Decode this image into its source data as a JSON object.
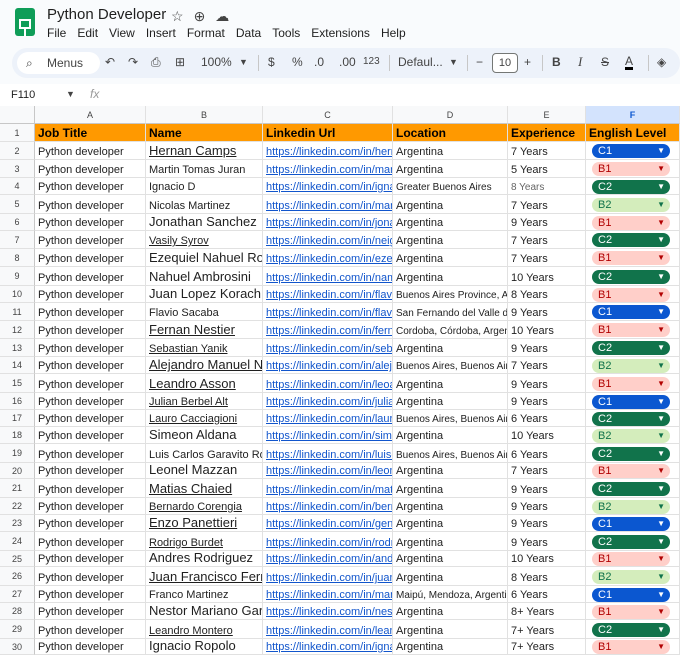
{
  "doc": {
    "title": "Python Developer"
  },
  "menu": [
    "File",
    "Edit",
    "View",
    "Insert",
    "Format",
    "Data",
    "Tools",
    "Extensions",
    "Help"
  ],
  "toolbar": {
    "menus_label": "Menus",
    "zoom": "100%",
    "currency": "$",
    "percent": "%",
    "dec_less": ".0",
    "dec_more": ".00",
    "format_123": "123",
    "font": "Defaul...",
    "font_size": "10"
  },
  "formula": {
    "cell_ref": "F110",
    "fx": "fx"
  },
  "columns": [
    "A",
    "B",
    "C",
    "D",
    "E",
    "F"
  ],
  "selected_column": "F",
  "headers": [
    "Job Title",
    "Name",
    "Linkedin Url",
    "Location",
    "Experience",
    "English Level"
  ],
  "levels": {
    "C1": {
      "bg": "#0b57d0",
      "fg": "#ffffff"
    },
    "C2": {
      "bg": "#11734b",
      "fg": "#ffffff"
    },
    "B2": {
      "bg": "#d4edbc",
      "fg": "#11734b"
    },
    "B1": {
      "bg": "#ffcfc9",
      "fg": "#b10202"
    }
  },
  "rows": [
    {
      "num": "2",
      "job": "Python developer",
      "name": "Hernan Camps",
      "url": "https://linkedin.com/in/hern%",
      "location": "Argentina",
      "experience": "7 Years",
      "level": "C1"
    },
    {
      "num": "3",
      "job": "Python developer",
      "name": "Martin Tomas Juran",
      "url": "https://linkedin.com/in/martin",
      "location": "Argentina",
      "experience": "5 Years",
      "level": "B1"
    },
    {
      "num": "4",
      "job": "Python developer",
      "name": "Ignacio D",
      "url": "https://linkedin.com/in/ignac",
      "location": "Greater Buenos Aires",
      "experience": "8 Years",
      "level": "C2"
    },
    {
      "num": "5",
      "job": "Python developer",
      "name": "Nicolas Martinez",
      "url": "https://linkedin.com/in/martin",
      "location": "Argentina",
      "experience": "7 Years",
      "level": "B2"
    },
    {
      "num": "6",
      "job": "Python developer",
      "name": "Jonathan Sanchez",
      "url": "https://linkedin.com/in/jonath",
      "location": "Argentina",
      "experience": "9 Years",
      "level": "B1"
    },
    {
      "num": "7",
      "job": "Python developer",
      "name": "Vasily Syrov",
      "url": "https://linkedin.com/in/neigri",
      "location": "Argentina",
      "experience": "7 Years",
      "level": "C2"
    },
    {
      "num": "8",
      "job": "Python developer",
      "name": "Ezequiel Nahuel Ron",
      "url": "https://linkedin.com/in/ezequ",
      "location": "Argentina",
      "experience": "7 Years",
      "level": "B1"
    },
    {
      "num": "9",
      "job": "Python developer",
      "name": "Nahuel Ambrosini",
      "url": "https://linkedin.com/in/namb",
      "location": "Argentina",
      "experience": "10 Years",
      "level": "C2"
    },
    {
      "num": "10",
      "job": "Python developer",
      "name": "Juan Lopez Korach",
      "url": "https://linkedin.com/in/flavio",
      "location": "Buenos Aires Province, A",
      "experience": "8 Years",
      "level": "B1"
    },
    {
      "num": "11",
      "job": "Python developer",
      "name": "Flavio Sacaba",
      "url": "https://linkedin.com/in/flavio",
      "location": "San Fernando del Valle de C",
      "experience": "9 Years",
      "level": "C1"
    },
    {
      "num": "12",
      "job": "Python developer",
      "name": "Fernan Nestier",
      "url": "https://linkedin.com/in/fernar",
      "location": "Cordoba, Córdoba, Argentin",
      "experience": "10 Years",
      "level": "B1"
    },
    {
      "num": "13",
      "job": "Python developer",
      "name": "Sebastian Yanik",
      "url": "https://linkedin.com/in/sebas",
      "location": "Argentina",
      "experience": "9 Years",
      "level": "C2"
    },
    {
      "num": "14",
      "job": "Python developer",
      "name": "Alejandro Manuel Na",
      "url": "https://linkedin.com/in/alejan",
      "location": "Buenos Aires, Buenos Aires",
      "experience": "7 Years",
      "level": "B2"
    },
    {
      "num": "15",
      "job": "Python developer",
      "name": "Leandro Asson",
      "url": "https://linkedin.com/in/leoas",
      "location": "Argentina",
      "experience": "9 Years",
      "level": "B1"
    },
    {
      "num": "16",
      "job": "Python developer",
      "name": "Julian Berbel Alt",
      "url": "https://linkedin.com/in/julian-",
      "location": "Argentina",
      "experience": "9 Years",
      "level": "C1"
    },
    {
      "num": "17",
      "job": "Python developer",
      "name": "Lauro Cacciagioni",
      "url": "https://linkedin.com/in/lauro-",
      "location": "Buenos Aires, Buenos Aires",
      "experience": "6 Years",
      "level": "C2"
    },
    {
      "num": "18",
      "job": "Python developer",
      "name": "Simeon Aldana",
      "url": "https://linkedin.com/in/simea",
      "location": "Argentina",
      "experience": "10 Years",
      "level": "B2"
    },
    {
      "num": "19",
      "job": "Python developer",
      "name": "Luis Carlos Garavito Ron",
      "url": "https://linkedin.com/in/luis-g",
      "location": "Buenos Aires, Buenos Aires",
      "experience": "6 Years",
      "level": "C2"
    },
    {
      "num": "20",
      "job": "Python developer",
      "name": "Leonel Mazzan",
      "url": "https://linkedin.com/in/leone",
      "location": "Argentina",
      "experience": "7 Years",
      "level": "B1"
    },
    {
      "num": "21",
      "job": "Python developer",
      "name": "Matias Chaied",
      "url": "https://linkedin.com/in/matia",
      "location": "Argentina",
      "experience": "9 Years",
      "level": "C2"
    },
    {
      "num": "22",
      "job": "Python developer",
      "name": "Bernardo Corengia",
      "url": "https://linkedin.com/in/berna",
      "location": "Argentina",
      "experience": "9 Years",
      "level": "B2"
    },
    {
      "num": "23",
      "job": "Python developer",
      "name": "Enzo Panettieri",
      "url": "https://linkedin.com/in/genzo",
      "location": "Argentina",
      "experience": "9 Years",
      "level": "C1"
    },
    {
      "num": "24",
      "job": "Python developer",
      "name": "Rodrigo Burdet",
      "url": "https://linkedin.com/in/rodrig",
      "location": "Argentina",
      "experience": "9 Years",
      "level": "C2"
    },
    {
      "num": "25",
      "job": "Python developer",
      "name": "Andres Rodriguez",
      "url": "https://linkedin.com/in/andre",
      "location": "Argentina",
      "experience": "10 Years",
      "level": "B1"
    },
    {
      "num": "26",
      "job": "Python developer",
      "name": "Juan Francisco Ferra",
      "url": "https://linkedin.com/in/juann",
      "location": "Argentina",
      "experience": "8 Years",
      "level": "B2"
    },
    {
      "num": "27",
      "job": "Python developer",
      "name": "Franco Martinez",
      "url": "https://linkedin.com/in/martin",
      "location": "Maipú, Mendoza, Argentina",
      "experience": "6 Years",
      "level": "C1"
    },
    {
      "num": "28",
      "job": "Python developer",
      "name": "Nestor Mariano Garc",
      "url": "https://linkedin.com/in/nesto",
      "location": "Argentina",
      "experience": "8+ Years",
      "level": "B1"
    },
    {
      "num": "29",
      "job": "Python developer",
      "name": "Leandro Montero",
      "url": "https://linkedin.com/in/leand",
      "location": "Argentina",
      "experience": "7+ Years",
      "level": "C2"
    },
    {
      "num": "30",
      "job": "Python developer",
      "name": "Ignacio Ropolo",
      "url": "https://linkedin.com/in/ignac",
      "location": "Argentina",
      "experience": "7+ Years",
      "level": "B1"
    }
  ]
}
